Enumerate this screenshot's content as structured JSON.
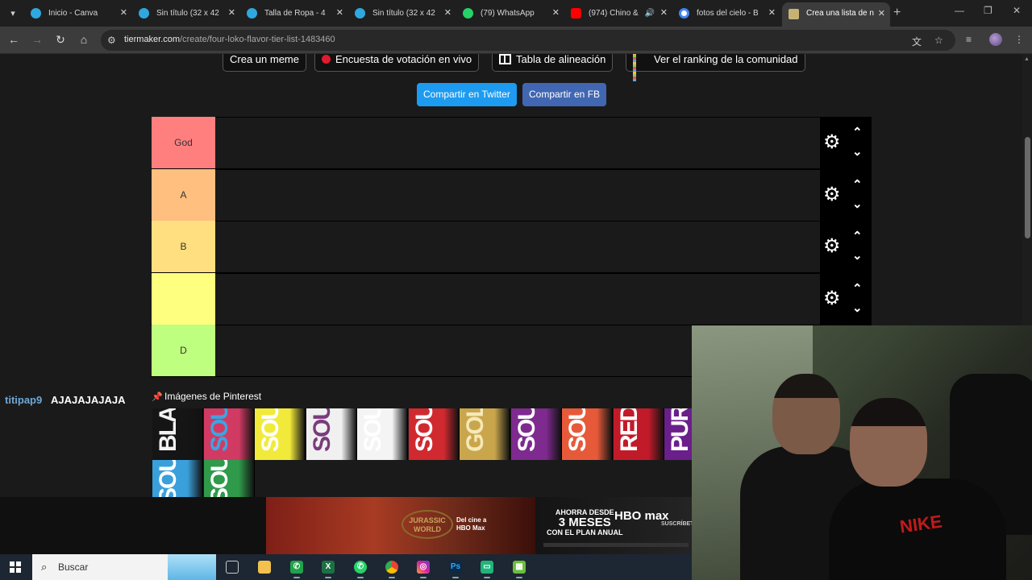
{
  "browser": {
    "tabs": [
      {
        "title": "Inicio - Canva",
        "favicon_color": "#2fa8e0"
      },
      {
        "title": "Sin título (32 x 42",
        "favicon_color": "#2fa8e0"
      },
      {
        "title": "Talla de Ropa - 4",
        "favicon_color": "#2fa8e0"
      },
      {
        "title": "Sin título (32 x 42",
        "favicon_color": "#2fa8e0"
      },
      {
        "title": "(79) WhatsApp",
        "favicon_color": "#25d366"
      },
      {
        "title": "(974) Chino &",
        "favicon_color": "#ff0000"
      },
      {
        "title": "fotos del cielo - B",
        "favicon_color": "#ffffff"
      },
      {
        "title": "Crea una lista de n",
        "favicon_color": "#c8b273"
      }
    ],
    "url_domain": "tiermaker.com",
    "url_path": "/create/four-loko-flavor-tier-list-1483460"
  },
  "top_buttons": {
    "meme": "Crea un meme",
    "poll": "Encuesta de votación en vivo",
    "alignment": "Tabla de alineación",
    "ranking": "Ver el ranking de la comunidad"
  },
  "share": {
    "twitter": "Compartir en Twitter",
    "facebook": "Compartir en FB",
    "twitter_color": "#1d9bf0",
    "facebook_color": "#4267b2"
  },
  "tiers": [
    {
      "label": "God",
      "color": "#ff7f7f"
    },
    {
      "label": "A",
      "color": "#ffbf7f"
    },
    {
      "label": "B",
      "color": "#ffdf7f"
    },
    {
      "label": "",
      "color": "#ffff7f"
    },
    {
      "label": "D",
      "color": "#bfff7f"
    }
  ],
  "chat": {
    "username": "titipap9",
    "message": "AJAJAJAJAJA",
    "username_color": "#6fa7d8"
  },
  "pinterest_label": "Imágenes de Pinterest",
  "cans": [
    {
      "text": "BLACK",
      "bg": "#151515",
      "fg": "#f2f2f2"
    },
    {
      "text": "SOUR",
      "bg": "#d13a63",
      "fg": "#3da5e0"
    },
    {
      "text": "SOUR",
      "bg": "#f2ea3a",
      "fg": "#ffffff"
    },
    {
      "text": "SOUR",
      "bg": "#f0f0f0",
      "fg": "#7a3b7c"
    },
    {
      "text": "SOUR",
      "bg": "#f4f4f4",
      "fg": "#ffffff"
    },
    {
      "text": "SOUR",
      "bg": "#d12930",
      "fg": "#ffffff"
    },
    {
      "text": "GOLD",
      "bg": "#c9a64c",
      "fg": "#f5e8b8"
    },
    {
      "text": "SOUR",
      "bg": "#7e2a8f",
      "fg": "#ffffff"
    },
    {
      "text": "SOUR",
      "bg": "#e65a3a",
      "fg": "#ffffff"
    },
    {
      "text": "RED",
      "bg": "#c11b2a",
      "fg": "#ffffff"
    },
    {
      "text": "PURPLE",
      "bg": "#6a1f8a",
      "fg": "#ffffff"
    },
    {
      "text": "SOUR",
      "bg": "#3aa0db",
      "fg": "#ffffff"
    },
    {
      "text": "SOUR",
      "bg": "#2f9a4a",
      "fg": "#ffffff"
    }
  ],
  "ad": {
    "logo": "JURASSIC WORLD",
    "tagline_1": "Del cine a",
    "tagline_2": "HBO Max",
    "promo_top": "AHORRA DESDE",
    "promo_big": "3 MESES",
    "promo_bottom": "CON EL PLAN ANUAL",
    "brand": "HBO max",
    "cta": "SUSCRÍBETE"
  },
  "webcam": {
    "shirt_text": "NIKE"
  },
  "taskbar": {
    "search_placeholder": "Buscar"
  }
}
